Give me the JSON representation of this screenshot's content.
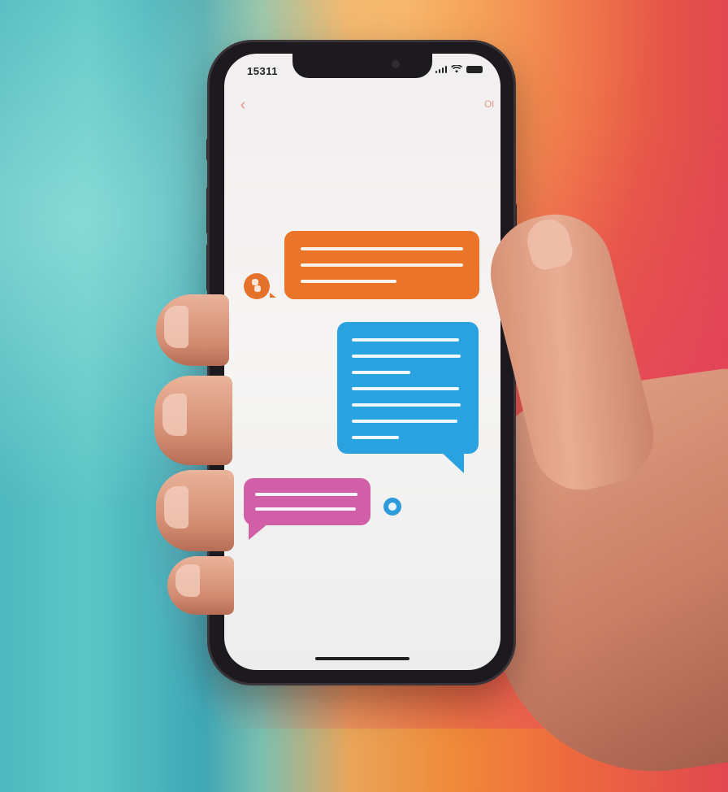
{
  "status_bar": {
    "time": "15311",
    "icons": [
      "signal-icon",
      "wifi-icon",
      "battery-icon"
    ]
  },
  "nav": {
    "back_glyph": "‹",
    "right_label": "Ol"
  },
  "messages": [
    {
      "sender": "orange",
      "color": "#ea7428",
      "lines": 3
    },
    {
      "sender": "blue",
      "color": "#2aa2e0",
      "lines": 7
    },
    {
      "sender": "pink",
      "color": "#d15fa8",
      "lines": 2
    }
  ],
  "colors": {
    "accent_orange": "#ea7428",
    "accent_blue": "#2aa2e0",
    "accent_pink": "#d15fa8",
    "nav_tint": "#e69a86"
  }
}
